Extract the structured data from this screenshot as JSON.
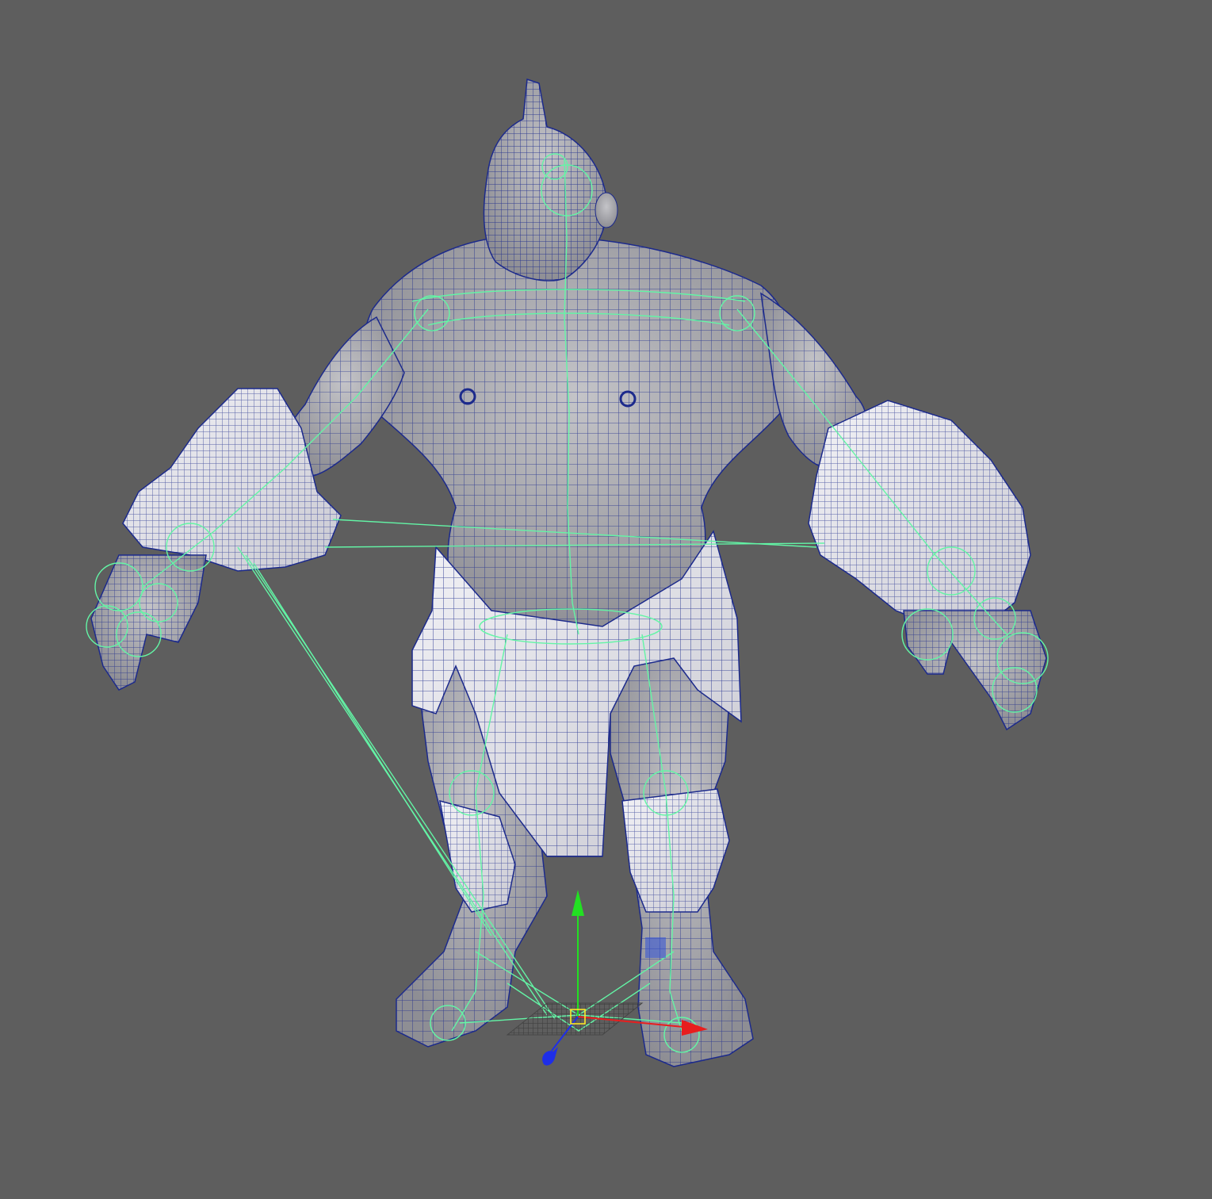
{
  "viewport": {
    "background": "#5e5e5e",
    "mesh_fill": "#a9a9ac",
    "mesh_fill_light": "#d8d8dc",
    "wire_color": "#1c2a8c",
    "rig_color": "#63f5a6",
    "axis_colors": {
      "x": "#e81e1e",
      "y": "#22e022",
      "z": "#1e2ee8"
    }
  },
  "scene": {
    "model": "ogre-character-mesh",
    "display_mode": "wireframe-on-shaded",
    "rig_visible": true,
    "manipulator": "move-tool"
  }
}
